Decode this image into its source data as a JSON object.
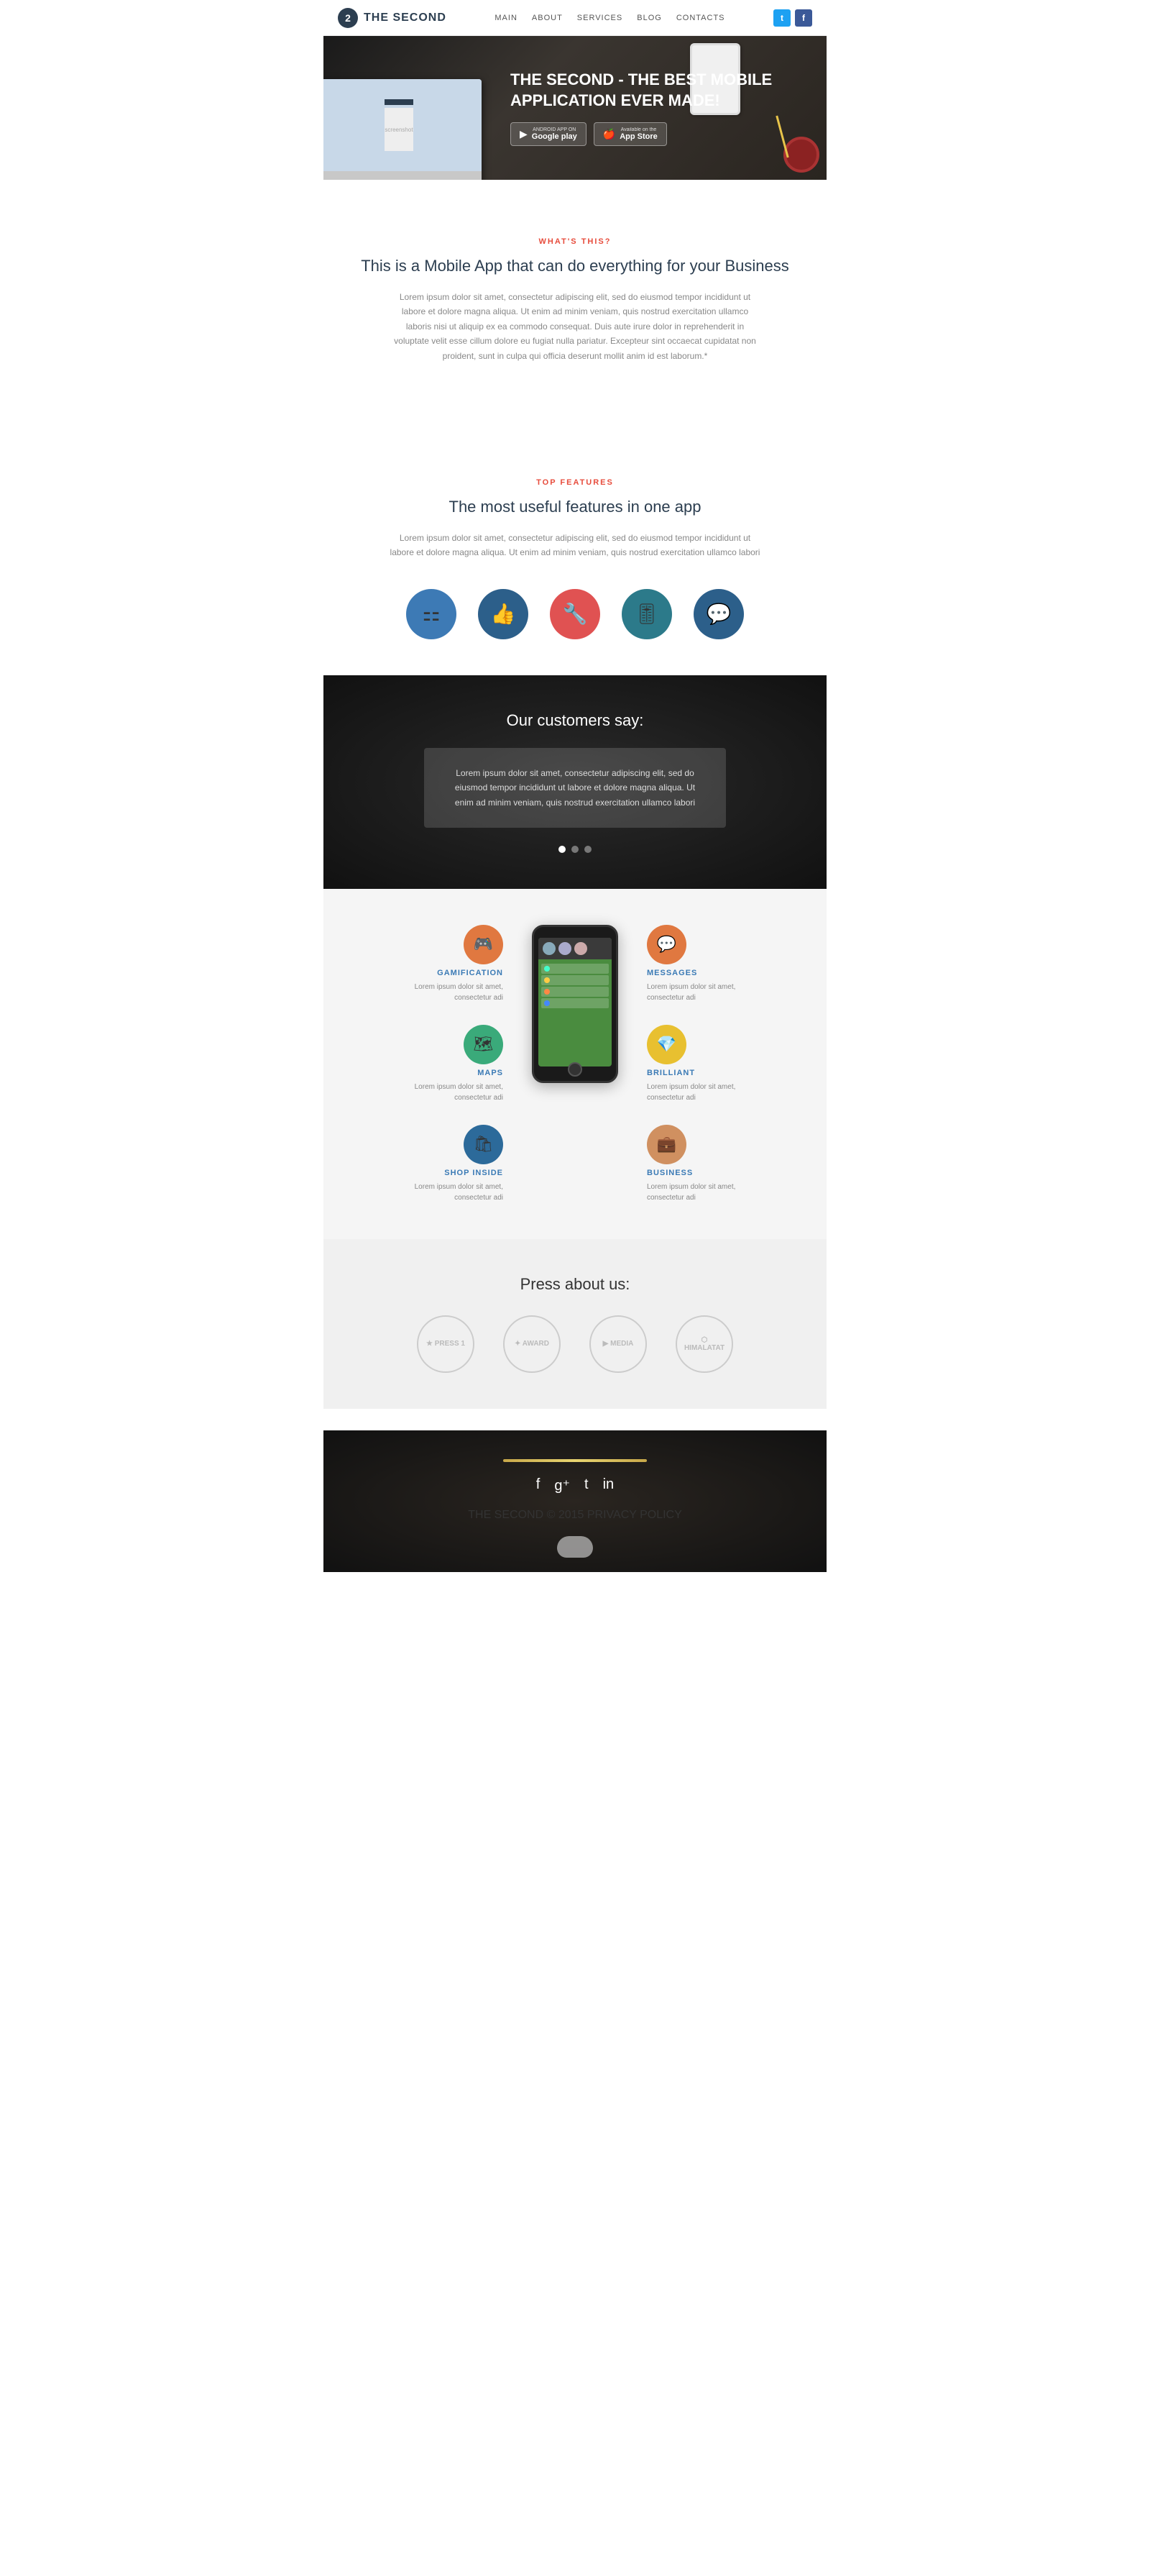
{
  "navbar": {
    "logo_letter": "2",
    "title": "THE SECOND",
    "links": [
      {
        "label": "MAIN",
        "href": "#"
      },
      {
        "label": "ABOUT",
        "href": "#"
      },
      {
        "label": "SERVICES",
        "href": "#"
      },
      {
        "label": "BLOG",
        "href": "#"
      },
      {
        "label": "CONTACTS",
        "href": "#"
      }
    ],
    "social": [
      {
        "name": "twitter",
        "letter": "t"
      },
      {
        "name": "facebook",
        "letter": "f"
      }
    ]
  },
  "hero": {
    "heading": "THE SECOND - THE BEST MOBILE APPLICATION EVER MADE!",
    "btn_google": {
      "top": "ANDROID APP ON",
      "main": "Google play"
    },
    "btn_apple": {
      "top": "Available on the",
      "main": "App Store"
    }
  },
  "whats_this": {
    "tag": "WHAT'S THIS?",
    "heading": "This is a Mobile App that can do everything for your Business",
    "body": "Lorem ipsum dolor sit amet, consectetur adipiscing elit, sed do eiusmod tempor incididunt ut labore et dolore magna aliqua. Ut enim ad minim veniam, quis nostrud exercitation ullamco laboris nisi ut aliquip ex ea commodo consequat. Duis aute irure dolor in reprehenderit in voluptate velit esse cillum dolore eu fugiat nulla pariatur. Excepteur sint occaecat cupidatat non proident, sunt in culpa qui officia deserunt mollit anim id est laborum.*"
  },
  "top_features": {
    "tag": "TOP FEATURES",
    "heading": "The most useful features in one app",
    "body": "Lorem ipsum dolor sit amet, consectetur adipiscing elit, sed do eiusmod tempor incididunt ut labore et dolore magna aliqua. Ut enim ad minim veniam, quis nostrud exercitation ullamco labori",
    "icons": [
      {
        "name": "apps-icon",
        "symbol": "⚏",
        "color_class": "fi-yellow"
      },
      {
        "name": "thumbsup-icon",
        "symbol": "👍",
        "color_class": "fi-blue"
      },
      {
        "name": "wrench-icon",
        "symbol": "🔧",
        "color_class": "fi-red"
      },
      {
        "name": "equalizer-icon",
        "symbol": "🎚",
        "color_class": "fi-teal"
      },
      {
        "name": "chat-icon",
        "symbol": "💬",
        "color_class": "fi-blue2"
      }
    ]
  },
  "customers": {
    "heading": "Our customers say:",
    "testimonial": "Lorem ipsum dolor sit amet, consectetur adipiscing elit, sed do eiusmod tempor incididunt ut labore et dolore magna aliqua. Ut enim ad minim veniam, quis nostrud exercitation ullamco labori",
    "dots": [
      {
        "active": true
      },
      {
        "active": false
      },
      {
        "active": false
      }
    ]
  },
  "app_features": {
    "left": [
      {
        "title": "GAMIFICATION",
        "desc": "Lorem ipsum dolor sit amet, consectetur adi",
        "icon": "🎮",
        "bg": "#e07840"
      },
      {
        "title": "MAPS",
        "desc": "Lorem ipsum dolor sit amet, consectetur adi",
        "icon": "🗺",
        "bg": "#3aaa7a"
      },
      {
        "title": "SHOP INSIDE",
        "desc": "Lorem ipsum dolor sit amet, consectetur adi",
        "icon": "🛍",
        "bg": "#2c6a9a"
      }
    ],
    "right": [
      {
        "title": "MESSAGES",
        "desc": "Lorem ipsum dolor sit amet, consectetur adi",
        "icon": "💬",
        "bg": "#e07840"
      },
      {
        "title": "BRILLIANT",
        "desc": "Lorem ipsum dolor sit amet, consectetur adi",
        "icon": "💎",
        "bg": "#e8c030"
      },
      {
        "title": "BUSINESS",
        "desc": "Lorem ipsum dolor sit amet, consectetur adi",
        "icon": "💼",
        "bg": "#d09060"
      }
    ]
  },
  "press": {
    "heading": "Press about us:",
    "logos": [
      {
        "text": "★ PRESS 1"
      },
      {
        "text": "✦ AWARD"
      },
      {
        "text": "▶ MEDIA"
      },
      {
        "text": "⬡ HIMALATAT"
      }
    ]
  },
  "footer": {
    "social_icons": [
      "f",
      "g+",
      "t",
      "in"
    ],
    "copyright": "THE SECOND © 2015",
    "privacy": "PRIVACY POLICY"
  }
}
